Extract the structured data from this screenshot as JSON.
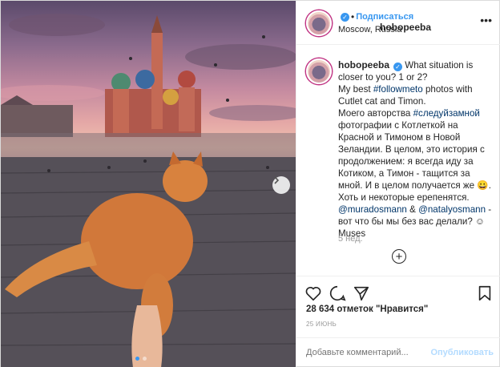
{
  "post": {
    "username": "hobopeeba",
    "follow_separator": "•",
    "follow_label": "Подписаться",
    "location": "Moscow, Russia",
    "more_icon": "more-horizontal-icon"
  },
  "caption": {
    "username": "hobopeeba",
    "text_1": "What situation is closer to you? 1 or 2?",
    "text_2": "My best",
    "tag_1": "#followmeto",
    "text_3": "photos with Cutlet cat and Timon.",
    "text_4": "Моего авторства",
    "tag_2": "#следуйзамной",
    "text_5": "фотографии с Котлеткой на Красной и Тимоном в Новой Зеландии. В целом, это история с продолжением: я всегда иду за Котиком, а Тимон - тащится за мной. И в целом получается же 😀. Хоть и некоторые ерепенятся.",
    "mention_1": "@muradosmann",
    "amp": "&",
    "mention_2": "@natalyosmann",
    "text_6": "- вот что бы мы без вас делали? ☺ Muses",
    "time_ago": "5 нед."
  },
  "actions": {
    "likes_count": "28 634",
    "likes_label": "отметок \"Нравится\"",
    "date": "25 ИЮНЬ"
  },
  "comment_box": {
    "placeholder": "Добавьте комментарий...",
    "post_label": "Опубликовать"
  },
  "carousel": {
    "slides": 2,
    "active": 1
  },
  "colors": {
    "accent": "#3897f0",
    "text": "#262626",
    "muted": "#999999",
    "tag": "#003569"
  }
}
